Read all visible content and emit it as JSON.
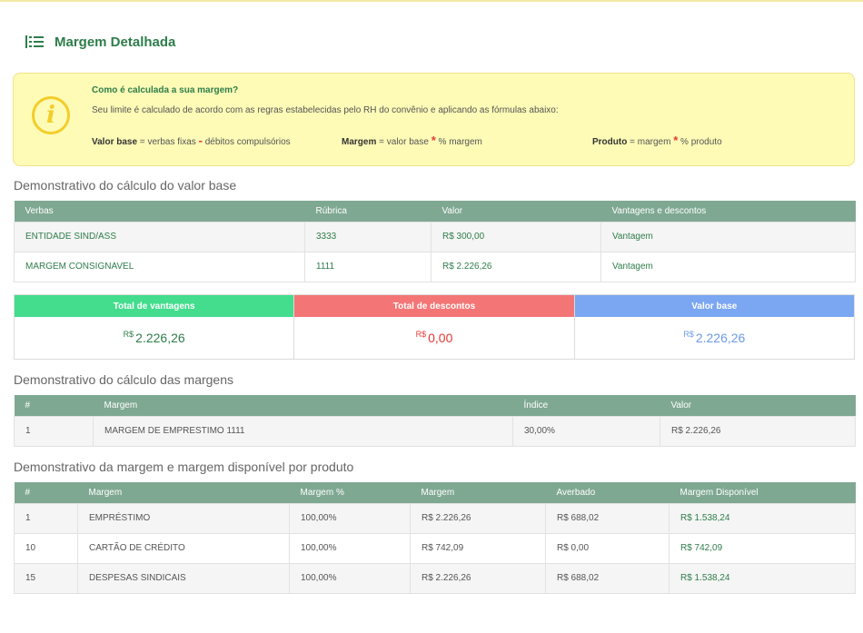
{
  "header": {
    "title": "Margem Detalhada"
  },
  "info": {
    "question": "Como é calculada a sua margem?",
    "description": "Seu limite é calculado de acordo com as regras estabelecidas pelo RH do convênio e aplicando as fórmulas abaixo:",
    "icon_letter": "i",
    "formulas": [
      {
        "label": "Valor base",
        "eq": "=",
        "a": "verbas fixas",
        "op": "-",
        "b": "débitos compulsórios"
      },
      {
        "label": "Margem",
        "eq": "=",
        "a": "valor base",
        "op": "*",
        "b": "% margem"
      },
      {
        "label": "Produto",
        "eq": "=",
        "a": "margem",
        "op": "*",
        "b": "% produto"
      }
    ]
  },
  "section1": {
    "title": "Demonstrativo do cálculo do valor base",
    "headers": [
      "Verbas",
      "Rúbrica",
      "Valor",
      "Vantagens e descontos"
    ],
    "rows": [
      [
        "ENTIDADE SIND/ASS",
        "3333",
        "R$ 300,00",
        "Vantagem"
      ],
      [
        "MARGEM CONSIGNAVEL",
        "1111",
        "R$ 2.226,26",
        "Vantagem"
      ]
    ]
  },
  "totals": [
    {
      "label": "Total de vantagens",
      "currency": "R$",
      "value": "2.226,26",
      "header_color": "#43dd8d",
      "value_color": "#2e7d4a"
    },
    {
      "label": "Total de descontos",
      "currency": "R$",
      "value": "0,00",
      "header_color": "#f47575",
      "value_color": "#e53935"
    },
    {
      "label": "Valor base",
      "currency": "R$",
      "value": "2.226,26",
      "header_color": "#7aa6f2",
      "value_color": "#6b9ae8"
    }
  ],
  "section2": {
    "title": "Demonstrativo do cálculo das margens",
    "headers": [
      "#",
      "Margem",
      "Índice",
      "Valor"
    ],
    "rows": [
      [
        "1",
        "MARGEM DE EMPRESTIMO 1111",
        "30,00%",
        "R$ 2.226,26"
      ]
    ]
  },
  "section3": {
    "title": "Demonstrativo da margem e margem disponível por produto",
    "headers": [
      "#",
      "Margem",
      "Margem %",
      "Margem",
      "Averbado",
      "Margem Disponível"
    ],
    "rows": [
      [
        "1",
        "EMPRÉSTIMO",
        "100,00%",
        "R$ 2.226,26",
        "R$ 688,02",
        "R$ 1.538,24"
      ],
      [
        "10",
        "CARTÃO DE CRÉDITO",
        "100,00%",
        "R$ 742,09",
        "R$ 0,00",
        "R$ 742,09"
      ],
      [
        "15",
        "DESPESAS SINDICAIS",
        "100,00%",
        "R$ 2.226,26",
        "R$ 688,02",
        "R$ 1.538,24"
      ]
    ]
  }
}
